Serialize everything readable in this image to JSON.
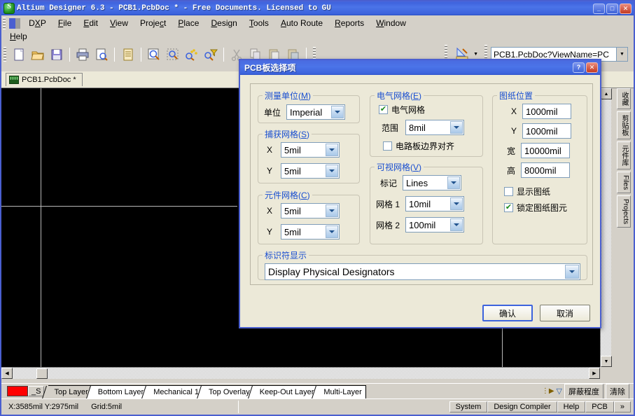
{
  "window": {
    "title": "Altium Designer 6.3 - PCB1.PcbDoc * - Free Documents. Licensed to GU",
    "minimize": "_",
    "maximize": "□",
    "close": "✕"
  },
  "menu": {
    "items": [
      "DXP",
      "File",
      "Edit",
      "View",
      "Project",
      "Place",
      "Design",
      "Tools",
      "Auto Route",
      "Reports",
      "Window"
    ],
    "row2": [
      "Help"
    ]
  },
  "toolbar": {
    "address_value": "PCB1.PcbDoc?ViewName=PC",
    "icons": [
      "new-doc-icon",
      "open-folder-icon",
      "save-icon",
      "print-icon",
      "print-preview-icon",
      "document-icon",
      "zoom-area-icon",
      "zoom-select-icon",
      "select-nets-icon",
      "filter-icon",
      "cut-icon",
      "copy-icon",
      "paste-icon",
      "paste-special-icon",
      "ruler-icon"
    ]
  },
  "doc_tab": {
    "label": "PCB1.PcbDoc *"
  },
  "right_panel": {
    "tabs": [
      "收藏",
      "剪贴板",
      "元件库",
      "Files",
      "Projects"
    ]
  },
  "dialog": {
    "title": "PCB板选择项",
    "help_btn": "?",
    "close_btn": "✕",
    "groups": {
      "measure_unit": {
        "legend": "测量单位(",
        "legend_key": "M",
        "legend_end": ")",
        "unit_label": "单位",
        "unit_value": "Imperial"
      },
      "snap_grid": {
        "legend": "捕获网格(",
        "legend_key": "S",
        "legend_end": ")",
        "x_label": "X",
        "x_value": "5mil",
        "y_label": "Y",
        "y_value": "5mil"
      },
      "component_grid": {
        "legend": "元件网格(",
        "legend_key": "C",
        "legend_end": ")",
        "x_label": "X",
        "x_value": "5mil",
        "y_label": "Y",
        "y_value": "5mil"
      },
      "electrical_grid": {
        "legend": "电气网格(",
        "legend_key": "E",
        "legend_end": ")",
        "enable_label": "电气网格",
        "enable_checked": true,
        "range_label": "范围",
        "range_value": "8mil",
        "snap_board_label": "电路板边界对齐",
        "snap_board_checked": false
      },
      "visible_grid": {
        "legend": "可视网格(",
        "legend_key": "V",
        "legend_end": ")",
        "marker_label": "标记",
        "marker_value": "Lines",
        "grid1_label": "网格 1",
        "grid1_value": "10mil",
        "grid2_label": "网格 2",
        "grid2_value": "100mil"
      },
      "sheet_position": {
        "legend": "图纸位置",
        "x_label": "X",
        "x_value": "1000mil",
        "y_label": "Y",
        "y_value": "1000mil",
        "w_label": "宽",
        "w_value": "10000mil",
        "h_label": "高",
        "h_value": "8000mil",
        "show_sheet_label": "显示图纸",
        "show_sheet_checked": false,
        "lock_sheet_label": "锁定图纸图元",
        "lock_sheet_checked": true
      },
      "designator_display": {
        "legend": "标识符显示",
        "value": "Display Physical Designators"
      }
    },
    "ok_button": "确认",
    "cancel_button": "取消"
  },
  "layer_bar": {
    "color_label": "_S",
    "tabs": [
      "Top Layer",
      "Bottom Layer",
      "Mechanical 1",
      "Top Overlay",
      "Keep-Out Layer",
      "Multi-Layer"
    ],
    "active_tab": "Top Layer",
    "mask_button": "屏蔽程度",
    "clear_button": "清除"
  },
  "status_bar": {
    "coords": "X:3585mil Y:2975mil",
    "grid": "Grid:5mil",
    "buttons": [
      "System",
      "Design Compiler",
      "Help",
      "PCB"
    ],
    "more": "»"
  }
}
